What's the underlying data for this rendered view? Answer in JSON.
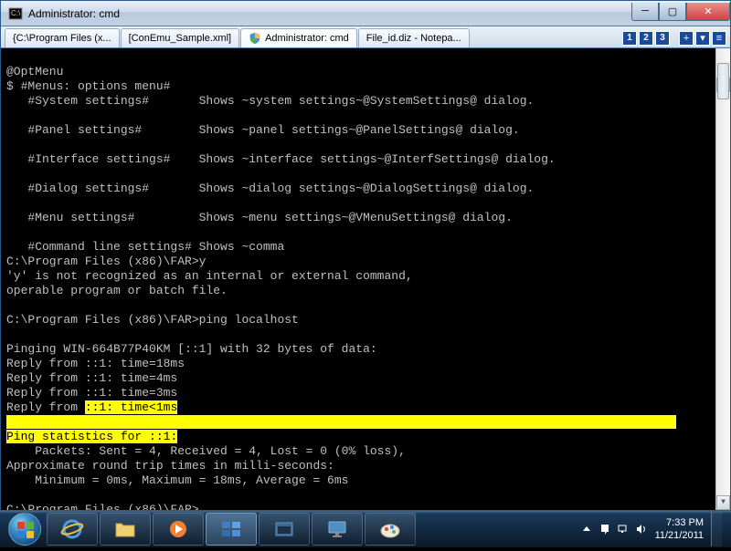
{
  "window": {
    "title": "Administrator: cmd"
  },
  "tabs": [
    {
      "label": "{C:\\Program Files (x..."
    },
    {
      "label": "[ConEmu_Sample.xml]"
    },
    {
      "label": "Administrator: cmd",
      "active": true
    },
    {
      "label": "File_id.diz - Notepa..."
    }
  ],
  "tab_numbers": [
    "1",
    "2",
    "3"
  ],
  "terminal": {
    "lines": [
      "@OptMenu",
      "$ #Menus: options menu#",
      "   #System settings#       Shows ~system settings~@SystemSettings@ dialog.",
      "",
      "   #Panel settings#        Shows ~panel settings~@PanelSettings@ dialog.",
      "",
      "   #Interface settings#    Shows ~interface settings~@InterfSettings@ dialog.",
      "",
      "   #Dialog settings#       Shows ~dialog settings~@DialogSettings@ dialog.",
      "",
      "   #Menu settings#         Shows ~menu settings~@VMenuSettings@ dialog.",
      "",
      "   #Command line settings# Shows ~comma",
      "C:\\Program Files (x86)\\FAR>y",
      "'y' is not recognized as an internal or external command,",
      "operable program or batch file.",
      "",
      "C:\\Program Files (x86)\\FAR>ping localhost",
      "",
      "Pinging WIN-664B77P40KM [::1] with 32 bytes of data:",
      "Reply from ::1: time=18ms",
      "Reply from ::1: time=4ms",
      "Reply from ::1: time=3ms"
    ],
    "hl1_prefix": "Reply from ",
    "hl1_text": "::1: time<1ms",
    "hl2_text": "Ping statistics for ::1",
    "hl2_cursor": ":",
    "after_lines": [
      "    Packets: Sent = 4, Received = 4, Lost = 0 (0% loss),",
      "Approximate round trip times in milli-seconds:",
      "    Minimum = 0ms, Maximum = 18ms, Average = 6ms",
      "",
      "C:\\Program Files (x86)\\FAR>"
    ]
  },
  "tray": {
    "time": "7:33 PM",
    "date": "11/21/2011"
  }
}
